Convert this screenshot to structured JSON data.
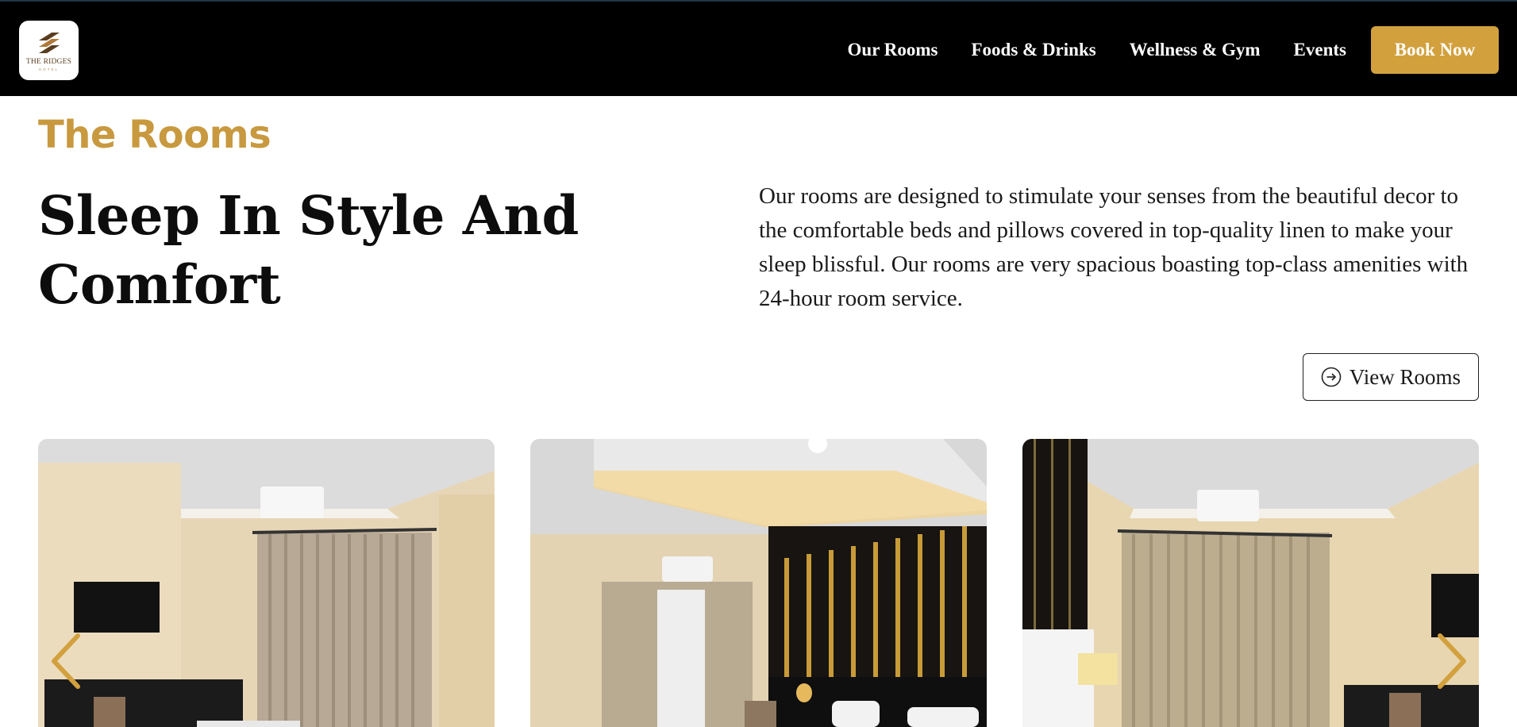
{
  "header": {
    "logo": {
      "name": "THE RIDGES",
      "sub": "HOTEL"
    },
    "nav": [
      {
        "label": "Our Rooms"
      },
      {
        "label": "Foods & Drinks"
      },
      {
        "label": "Wellness & Gym"
      },
      {
        "label": "Events"
      }
    ],
    "cta": {
      "label": "Book Now"
    }
  },
  "section": {
    "eyebrow": "The Rooms",
    "headline": "Sleep In Style And Comfort",
    "description": "Our rooms are designed to stimulate your senses from the beautiful decor to the comfortable beds and pillows covered in top-quality linen to make your sleep blissful. Our rooms are very spacious boasting top-class amenities with 24-hour room service.",
    "view_button": {
      "label": "View Rooms",
      "icon": "arrow-circle-right-icon"
    }
  },
  "gallery": {
    "prev_icon": "chevron-left-icon",
    "next_icon": "chevron-right-icon",
    "photos": [
      {
        "name": "room-photo-1"
      },
      {
        "name": "room-photo-2"
      },
      {
        "name": "room-photo-3"
      }
    ]
  },
  "colors": {
    "header_bg": "#000000",
    "accent": "#d2a13e",
    "eyebrow": "#c8993f",
    "text": "#111111"
  }
}
